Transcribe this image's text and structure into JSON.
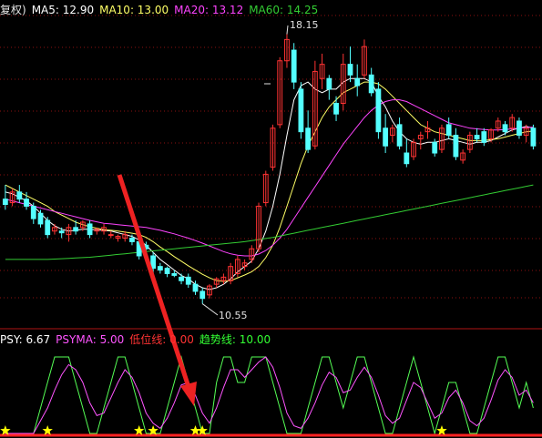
{
  "legend_top": {
    "prefix": "复权)",
    "ma5": "MA5: 12.90",
    "ma10": "MA10: 13.00",
    "ma20": "MA20: 13.12",
    "ma60": "MA60: 14.25"
  },
  "legend_bottom": {
    "psy": "PSY: 6.67",
    "psyma": "PSYMA: 5.00",
    "low_line": "低位线: 0.00",
    "trend_line": "趋势线: 10.00"
  },
  "annotations": {
    "high": "18.15",
    "low": "10.55"
  },
  "colors": {
    "ma5": "#ffffff",
    "ma10": "#ffff66",
    "ma20": "#ff44ff",
    "ma60": "#33cc33",
    "up": "#ff3333",
    "down": "#54ffff",
    "grid": "#8b1010",
    "psy": "#55ff55",
    "psyma": "#ff55ff",
    "low_line": "#ff2222",
    "trend_line": "#33ff33",
    "star": "#ffff00",
    "arrow": "#ee2222"
  },
  "chart_data": [
    {
      "type": "candlestick",
      "title": "",
      "ylim": [
        10.0,
        18.6
      ],
      "grid": true,
      "annotations": [
        {
          "label": "18.15",
          "value": 18.15
        },
        {
          "label": "10.55",
          "value": 10.55
        }
      ],
      "ohlc": [
        [
          13.5,
          13.9,
          13.2,
          13.35
        ],
        [
          13.4,
          13.8,
          13.3,
          13.7
        ],
        [
          13.7,
          13.9,
          13.4,
          13.5
        ],
        [
          13.5,
          13.7,
          13.2,
          13.3
        ],
        [
          13.3,
          13.4,
          12.8,
          12.95
        ],
        [
          13.1,
          13.2,
          12.7,
          12.8
        ],
        [
          12.9,
          13.0,
          12.4,
          12.5
        ],
        [
          12.6,
          12.8,
          12.5,
          12.7
        ],
        [
          12.6,
          12.7,
          12.4,
          12.55
        ],
        [
          12.5,
          12.8,
          12.3,
          12.7
        ],
        [
          12.7,
          12.9,
          12.5,
          12.6
        ],
        [
          12.7,
          12.9,
          12.6,
          12.85
        ],
        [
          12.8,
          12.9,
          12.4,
          12.5
        ],
        [
          12.6,
          12.7,
          12.5,
          12.65
        ],
        [
          12.6,
          12.8,
          12.5,
          12.7
        ],
        [
          12.5,
          12.6,
          12.4,
          12.5
        ],
        [
          12.4,
          12.5,
          12.3,
          12.45
        ],
        [
          12.4,
          12.6,
          12.3,
          12.5
        ],
        [
          12.4,
          12.5,
          12.2,
          12.3
        ],
        [
          12.3,
          12.4,
          11.8,
          11.9
        ],
        [
          12.2,
          12.3,
          11.9,
          12.1
        ],
        [
          11.9,
          12.0,
          11.4,
          11.55
        ],
        [
          11.6,
          11.7,
          11.4,
          11.5
        ],
        [
          11.55,
          11.6,
          11.3,
          11.4
        ],
        [
          11.4,
          11.5,
          11.3,
          11.35
        ],
        [
          11.3,
          11.4,
          11.1,
          11.2
        ],
        [
          11.3,
          11.4,
          11.0,
          11.1
        ],
        [
          11.1,
          11.2,
          10.8,
          10.9
        ],
        [
          10.9,
          11.0,
          10.55,
          10.7
        ],
        [
          10.8,
          11.1,
          10.7,
          11.05
        ],
        [
          11.1,
          11.3,
          11.0,
          11.25
        ],
        [
          11.2,
          11.4,
          11.1,
          11.3
        ],
        [
          11.2,
          11.7,
          11.1,
          11.6
        ],
        [
          11.4,
          11.9,
          11.3,
          11.8
        ],
        [
          11.6,
          11.8,
          11.5,
          11.7
        ],
        [
          11.8,
          12.2,
          11.7,
          12.1
        ],
        [
          12.1,
          13.4,
          12.0,
          13.3
        ],
        [
          13.4,
          14.3,
          13.3,
          14.2
        ],
        [
          14.4,
          15.6,
          14.3,
          15.5
        ],
        [
          15.6,
          17.5,
          15.5,
          17.4
        ],
        [
          17.4,
          18.15,
          17.2,
          18.0
        ],
        [
          17.7,
          17.9,
          16.6,
          16.8
        ],
        [
          16.6,
          16.8,
          15.2,
          15.4
        ],
        [
          15.5,
          16.0,
          14.8,
          14.9
        ],
        [
          15.0,
          17.4,
          14.9,
          17.1
        ],
        [
          16.9,
          17.6,
          16.6,
          17.3
        ],
        [
          16.9,
          17.0,
          16.3,
          16.6
        ],
        [
          16.2,
          16.4,
          15.7,
          15.9
        ],
        [
          16.2,
          17.6,
          16.0,
          17.3
        ],
        [
          17.3,
          17.8,
          16.8,
          17.0
        ],
        [
          16.9,
          17.3,
          16.4,
          16.7
        ],
        [
          17.0,
          18.0,
          16.9,
          17.8
        ],
        [
          17.0,
          17.2,
          16.4,
          16.5
        ],
        [
          16.6,
          16.8,
          15.2,
          15.4
        ],
        [
          15.5,
          15.9,
          14.8,
          15.0
        ],
        [
          15.3,
          15.6,
          15.1,
          15.5
        ],
        [
          15.6,
          15.8,
          14.9,
          15.0
        ],
        [
          14.8,
          15.2,
          14.4,
          14.5
        ],
        [
          14.7,
          15.2,
          14.6,
          15.1
        ],
        [
          15.2,
          15.4,
          14.9,
          15.3
        ],
        [
          15.4,
          15.7,
          15.2,
          15.5
        ],
        [
          15.1,
          15.2,
          14.7,
          14.8
        ],
        [
          14.9,
          15.6,
          14.8,
          15.5
        ],
        [
          15.6,
          15.8,
          15.2,
          15.3
        ],
        [
          15.3,
          15.5,
          14.6,
          14.7
        ],
        [
          14.6,
          14.9,
          14.5,
          14.8
        ],
        [
          14.9,
          15.4,
          14.8,
          15.3
        ],
        [
          15.3,
          15.5,
          15.1,
          15.2
        ],
        [
          15.4,
          15.5,
          15.0,
          15.1
        ],
        [
          15.2,
          15.5,
          15.1,
          15.45
        ],
        [
          15.5,
          15.8,
          15.4,
          15.7
        ],
        [
          15.6,
          15.7,
          15.3,
          15.4
        ],
        [
          15.5,
          15.9,
          15.4,
          15.8
        ],
        [
          15.7,
          15.8,
          15.2,
          15.3
        ],
        [
          15.3,
          15.6,
          15.1,
          15.5
        ],
        [
          15.5,
          15.6,
          14.9,
          15.0
        ]
      ],
      "series": [
        {
          "name": "MA5",
          "values": [
            13.7,
            13.65,
            13.55,
            13.45,
            13.3,
            13.1,
            12.9,
            12.75,
            12.65,
            12.6,
            12.62,
            12.65,
            12.65,
            12.63,
            12.62,
            12.6,
            12.55,
            12.5,
            12.45,
            12.35,
            12.2,
            12.0,
            11.8,
            11.65,
            11.5,
            11.35,
            11.25,
            11.1,
            11.0,
            10.95,
            11.0,
            11.1,
            11.25,
            11.45,
            11.6,
            11.75,
            12.1,
            12.6,
            13.3,
            14.2,
            15.3,
            16.3,
            16.7,
            16.8,
            16.6,
            16.5,
            16.6,
            16.6,
            16.8,
            16.9,
            16.9,
            16.9,
            16.8,
            16.4,
            16.1,
            15.7,
            15.4,
            15.2,
            15.1,
            15.05,
            15.1,
            15.1,
            15.15,
            15.2,
            15.15,
            15.1,
            15.05,
            15.1,
            15.1,
            15.15,
            15.25,
            15.35,
            15.45,
            15.5,
            15.55,
            15.5
          ]
        },
        {
          "name": "MA10",
          "values": [
            13.9,
            13.8,
            13.7,
            13.6,
            13.5,
            13.4,
            13.3,
            13.15,
            13.05,
            12.95,
            12.85,
            12.78,
            12.72,
            12.68,
            12.64,
            12.62,
            12.6,
            12.57,
            12.54,
            12.5,
            12.42,
            12.3,
            12.15,
            12.02,
            11.88,
            11.75,
            11.62,
            11.5,
            11.38,
            11.28,
            11.2,
            11.18,
            11.2,
            11.28,
            11.36,
            11.45,
            11.6,
            11.85,
            12.2,
            12.7,
            13.3,
            13.9,
            14.5,
            15.0,
            15.4,
            15.8,
            16.1,
            16.3,
            16.5,
            16.6,
            16.7,
            16.8,
            16.8,
            16.75,
            16.6,
            16.4,
            16.2,
            16.0,
            15.8,
            15.6,
            15.5,
            15.4,
            15.35,
            15.3,
            15.25,
            15.2,
            15.15,
            15.15,
            15.15,
            15.18,
            15.2,
            15.25,
            15.3,
            15.35,
            15.4,
            15.42
          ]
        },
        {
          "name": "MA20",
          "values": [
            13.5,
            13.45,
            13.4,
            13.35,
            13.3,
            13.25,
            13.2,
            13.15,
            13.1,
            13.05,
            13.0,
            12.95,
            12.9,
            12.86,
            12.82,
            12.8,
            12.78,
            12.76,
            12.74,
            12.72,
            12.7,
            12.66,
            12.62,
            12.57,
            12.52,
            12.46,
            12.4,
            12.33,
            12.26,
            12.18,
            12.1,
            12.02,
            11.96,
            11.92,
            11.9,
            11.9,
            11.95,
            12.05,
            12.2,
            12.4,
            12.65,
            12.95,
            13.25,
            13.55,
            13.85,
            14.15,
            14.45,
            14.75,
            15.05,
            15.3,
            15.55,
            15.8,
            16.0,
            16.15,
            16.25,
            16.3,
            16.3,
            16.25,
            16.15,
            16.05,
            15.95,
            15.85,
            15.75,
            15.65,
            15.6,
            15.55,
            15.5,
            15.48,
            15.46,
            15.45,
            15.45,
            15.46,
            15.48,
            15.5,
            15.52,
            15.53
          ]
        },
        {
          "name": "MA60",
          "values": [
            11.8,
            11.8,
            11.8,
            11.8,
            11.8,
            11.8,
            11.8,
            11.81,
            11.82,
            11.83,
            11.84,
            11.85,
            11.86,
            11.88,
            11.9,
            11.92,
            11.94,
            11.96,
            11.98,
            12.0,
            12.02,
            12.04,
            12.06,
            12.08,
            12.1,
            12.12,
            12.14,
            12.16,
            12.18,
            12.2,
            12.22,
            12.24,
            12.26,
            12.28,
            12.3,
            12.33,
            12.36,
            12.39,
            12.42,
            12.46,
            12.5,
            12.54,
            12.58,
            12.62,
            12.66,
            12.7,
            12.74,
            12.78,
            12.82,
            12.86,
            12.9,
            12.94,
            12.98,
            13.02,
            13.06,
            13.1,
            13.14,
            13.18,
            13.22,
            13.26,
            13.3,
            13.34,
            13.38,
            13.42,
            13.46,
            13.5,
            13.54,
            13.58,
            13.62,
            13.66,
            13.7,
            13.74,
            13.78,
            13.82,
            13.86,
            13.9
          ]
        }
      ]
    },
    {
      "type": "line",
      "title": "",
      "ylim": [
        0,
        100
      ],
      "series": [
        {
          "name": "PSY",
          "values": [
            0,
            0,
            0,
            0,
            0,
            10,
            20,
            30,
            30,
            30,
            20,
            10,
            0,
            0,
            10,
            20,
            30,
            30,
            20,
            10,
            0,
            0,
            0,
            10,
            20,
            30,
            20,
            10,
            0,
            0,
            20,
            30,
            30,
            20,
            20,
            30,
            30,
            30,
            20,
            10,
            0,
            0,
            0,
            10,
            20,
            30,
            30,
            20,
            10,
            20,
            30,
            30,
            20,
            10,
            0,
            0,
            10,
            20,
            30,
            20,
            10,
            0,
            10,
            20,
            20,
            10,
            0,
            0,
            10,
            20,
            30,
            30,
            20,
            10,
            20,
            10
          ]
        },
        {
          "name": "PSYMA",
          "values": [
            0,
            0,
            0,
            0,
            0,
            5,
            10,
            17,
            23,
            27,
            25,
            20,
            12,
            7,
            8,
            14,
            20,
            25,
            22,
            16,
            8,
            4,
            2,
            6,
            12,
            19,
            20,
            15,
            8,
            4,
            10,
            18,
            25,
            25,
            22,
            25,
            28,
            30,
            26,
            18,
            8,
            3,
            2,
            6,
            12,
            19,
            24,
            22,
            16,
            17,
            22,
            26,
            22,
            15,
            7,
            4,
            6,
            13,
            20,
            18,
            12,
            6,
            8,
            14,
            17,
            12,
            5,
            3,
            6,
            13,
            21,
            25,
            22,
            15,
            17,
            12
          ]
        },
        {
          "name": "低位线",
          "values": [
            0
          ]
        },
        {
          "name": "趋势线",
          "values": [
            10
          ]
        }
      ],
      "markers": [
        0,
        6,
        19,
        21,
        27,
        28,
        62
      ]
    }
  ]
}
